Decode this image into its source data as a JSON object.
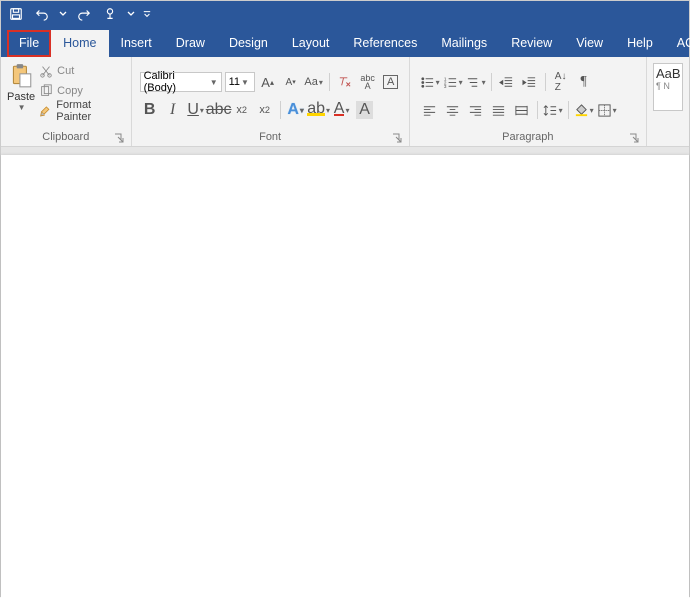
{
  "qat": [
    "save",
    "undo",
    "redo",
    "touch-mode",
    "customize"
  ],
  "tabs": {
    "file": "File",
    "home": "Home",
    "others": [
      "Insert",
      "Draw",
      "Design",
      "Layout",
      "References",
      "Mailings",
      "Review",
      "View",
      "Help",
      "ACROBAT"
    ]
  },
  "clipboard": {
    "paste": "Paste",
    "cut": "Cut",
    "copy": "Copy",
    "format_painter": "Format Painter",
    "group_label": "Clipboard"
  },
  "font": {
    "family": "Calibri (Body)",
    "size": "11",
    "group_label": "Font"
  },
  "paragraph": {
    "group_label": "Paragraph"
  },
  "styles": {
    "preview1": "AaB",
    "preview1_sub": "¶ N"
  }
}
